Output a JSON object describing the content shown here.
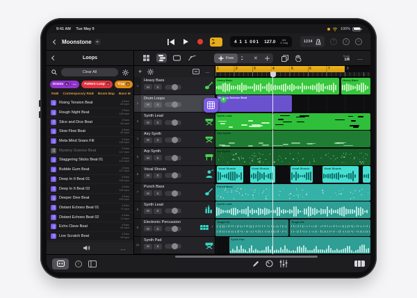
{
  "status_bar": {
    "time": "9:41 AM",
    "date": "Tue May 9",
    "battery_level": "100%"
  },
  "app_header": {
    "project_title": "Moonstone"
  },
  "transport": {
    "position": "4 1 1 001",
    "tempo": "127.0",
    "time_signature": "4/4",
    "key": "C maj",
    "count_in": "1234"
  },
  "tools": {
    "free_tool": "Free",
    "snap_label": "Snap",
    "snap_value": "1/8",
    "more": "…"
  },
  "loops_panel": {
    "title": "Loops",
    "clear_all": "Clear All",
    "chips": [
      {
        "label": "Drums",
        "more": "…",
        "color": "#9333cc"
      },
      {
        "label": "Pattern Loop",
        "color": "#e0343f"
      },
      {
        "label": "Trap",
        "color": "#e08b18"
      }
    ],
    "tags": [
      "R&B",
      "Contemporary R&B",
      "Boom Bap",
      "Bass M"
    ],
    "items": [
      {
        "name": "Rising Tension Beat",
        "length": "4 Bars",
        "bpm": "85 bpm"
      },
      {
        "name": "Rough Night Beat",
        "length": "2 Bars",
        "bpm": "138 bpm"
      },
      {
        "name": "Slice and Dice Beat",
        "length": "4 Bars",
        "bpm": "84 bpm"
      },
      {
        "name": "Slow Flow Beat",
        "length": "4 Bars",
        "bpm": "80 bpm"
      },
      {
        "name": "Meta Mind Snare Fill",
        "length": "2 Bars",
        "bpm": "138 bpm"
      },
      {
        "name": "Mystery Science Beat",
        "length": "2 Bars",
        "bpm": "117 bpm",
        "dimmed": true
      },
      {
        "name": "Staggering Sticks Beat 01",
        "length": "4 Bars",
        "bpm": "123 bpm"
      },
      {
        "name": "Bubble Gum Beat",
        "length": "4 Bars",
        "bpm": "117 bpm"
      },
      {
        "name": "Deep In It Beat 01",
        "length": "4 Bars",
        "bpm": "135 bpm"
      },
      {
        "name": "Deep In It Beat 02",
        "length": "4 Bars",
        "bpm": "135 bpm"
      },
      {
        "name": "Deeper Dive Beat",
        "length": "4 Bars",
        "bpm": "135 bpm"
      },
      {
        "name": "Distant Echoes Beat 01",
        "length": "4 Bars",
        "bpm": "74 bpm"
      },
      {
        "name": "Distant Echoes Beat 02",
        "length": "4 Bars",
        "bpm": "74 bpm"
      },
      {
        "name": "Echo Clave Beat",
        "length": "4 Bars",
        "bpm": "84 bpm"
      },
      {
        "name": "Live Scratch Beat",
        "length": "4 Bars",
        "bpm": "95 bpm"
      }
    ]
  },
  "tracks_ui": {
    "mute": "M",
    "solo": "S"
  },
  "track_list": [
    {
      "num": "1",
      "name": "Heavy Bass"
    },
    {
      "num": "2",
      "name": "Drum Loops"
    },
    {
      "num": "3",
      "name": "Synth Lead"
    },
    {
      "num": "4",
      "name": "Airy Synth"
    },
    {
      "num": "5",
      "name": "Arp Synth"
    },
    {
      "num": "6",
      "name": "Vocal Shouts"
    },
    {
      "num": "7",
      "name": "Punch Bass"
    },
    {
      "num": "8",
      "name": "Synth Lead"
    },
    {
      "num": "9",
      "name": "Electronic Percussion"
    },
    {
      "num": "11",
      "name": "Synth Pad"
    }
  ],
  "timeline": {
    "bars": [
      "1",
      "2",
      "3",
      "4",
      "5",
      "6",
      "7",
      "8"
    ],
    "regions": {
      "heavy_bass_a": "Heavy Bass",
      "heavy_bass_b": "Heavy Bass",
      "mystery_science": "Mystery Science Beat",
      "synth_lead_midi": "Synth Lead",
      "airy_synth": "Airy Synth",
      "arp_synth": "Arp Synth",
      "vocal_1": "Vocal Shouts",
      "vocal_2": "Vocal Shouts",
      "vocal_3": "Vocal Shouts",
      "vocal_4": "Vocal Shouts",
      "punch_bass": "Punch Bass",
      "synth_lead_audio": "Synth Lead",
      "tough_kit_a": "Tough Kit",
      "tough_kit_b": "Tough Kit",
      "synth_pad": "Synth Pad"
    }
  }
}
